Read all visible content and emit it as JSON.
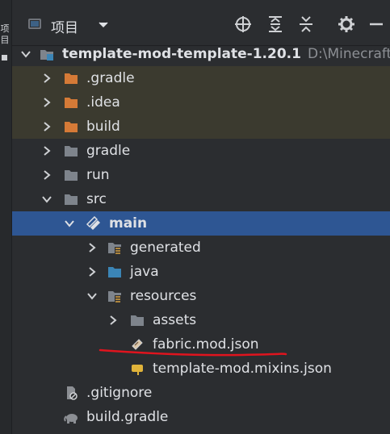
{
  "left_strip": {
    "chars": [
      "项",
      "目"
    ]
  },
  "toolbar": {
    "title": "项目",
    "icons": [
      "project-panel-icon",
      "chevron-down-icon",
      "locate-icon",
      "expand-all-icon",
      "collapse-all-icon",
      "gear-icon",
      "minimize-icon"
    ]
  },
  "tree": {
    "root": {
      "label": "template-mod-template-1.20.1",
      "path": "D:\\Minecraft\\"
    },
    "items": [
      {
        "label": ".gradle"
      },
      {
        "label": ".idea"
      },
      {
        "label": "build"
      },
      {
        "label": "gradle"
      },
      {
        "label": "run"
      },
      {
        "label": "src"
      },
      {
        "label": "main"
      },
      {
        "label": "generated"
      },
      {
        "label": "java"
      },
      {
        "label": "resources"
      },
      {
        "label": "assets"
      },
      {
        "label": "fabric.mod.json"
      },
      {
        "label": "template-mod.mixins.json"
      },
      {
        "label": ".gitignore"
      },
      {
        "label": "build.gradle"
      }
    ]
  },
  "colors": {
    "background": "#2b2d30",
    "selection": "#2e5693",
    "excluded_row": "#3b3a2f",
    "excluded_folder": "#d57a37",
    "folder": "#7e848c",
    "source_folder": "#3b85b6",
    "annotation": "#e0141e"
  }
}
